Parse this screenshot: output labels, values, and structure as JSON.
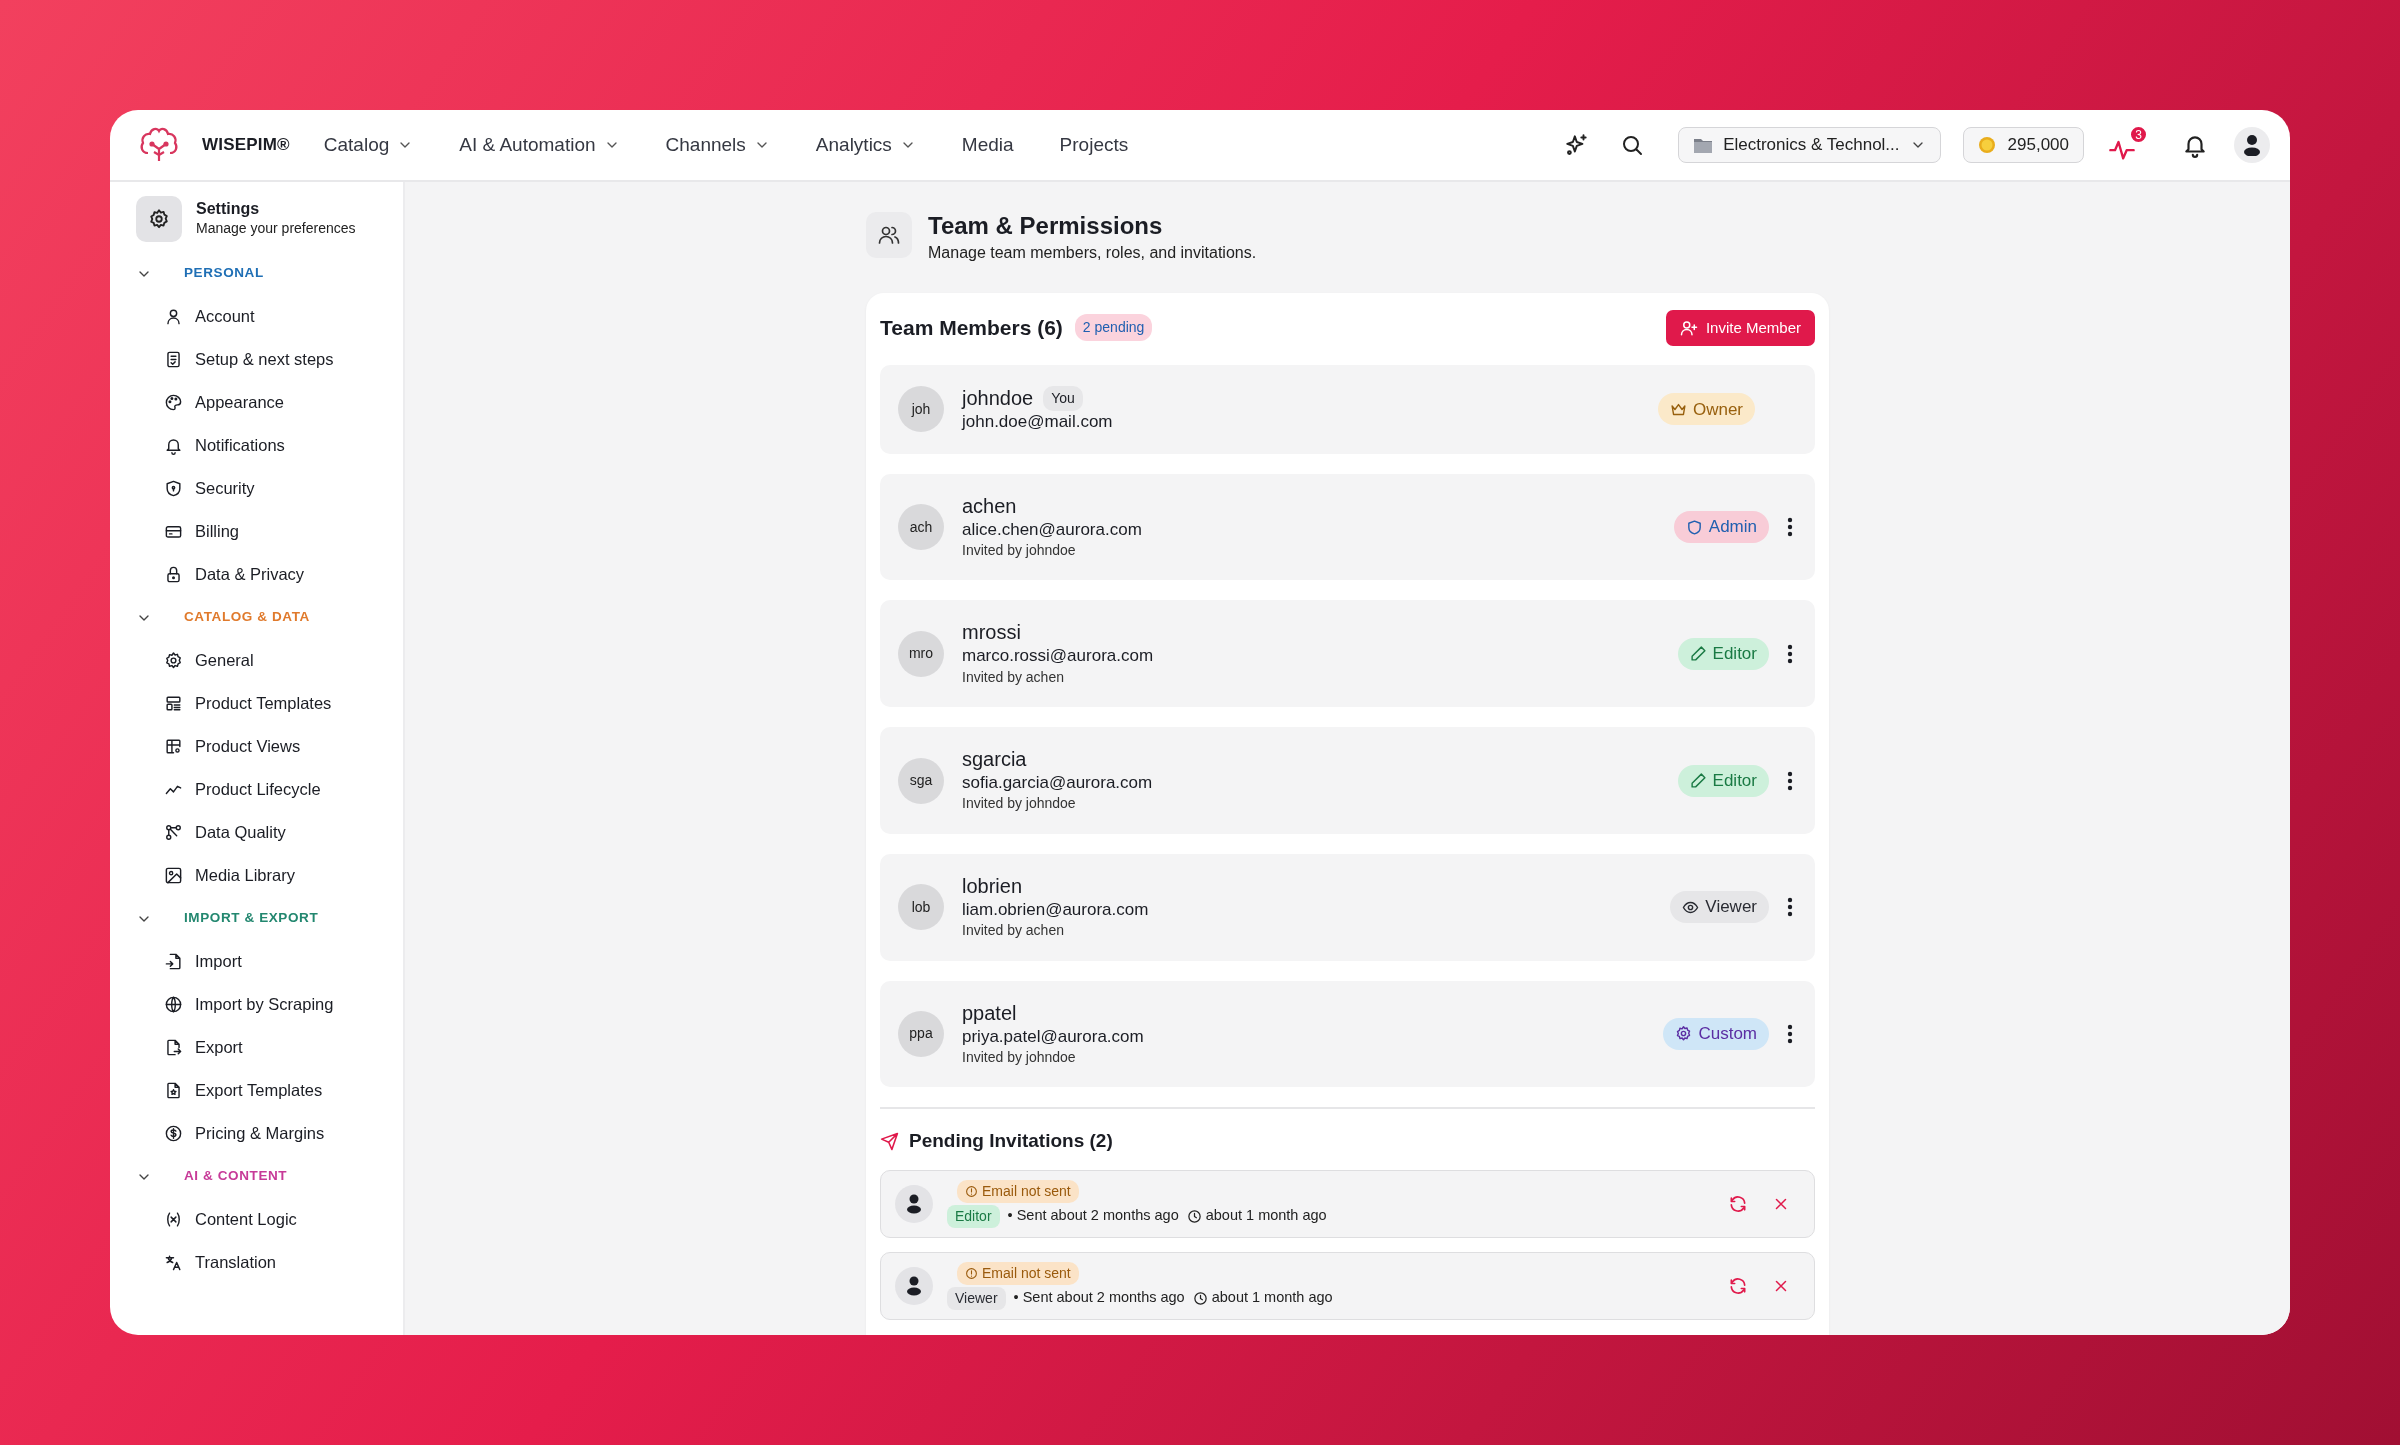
{
  "navbar": {
    "brand": "WISEPIM®",
    "menu": [
      {
        "label": "Catalog",
        "dropdown": true
      },
      {
        "label": "AI & Automation",
        "dropdown": true
      },
      {
        "label": "Channels",
        "dropdown": true
      },
      {
        "label": "Analytics",
        "dropdown": true
      },
      {
        "label": "Media",
        "dropdown": false
      },
      {
        "label": "Projects",
        "dropdown": false
      }
    ],
    "workspace": "Electronics & Technol...",
    "credits": "295,000",
    "activity_count": "3"
  },
  "sidebar": {
    "title": "Settings",
    "subtitle": "Manage your preferences",
    "sections": [
      {
        "title": "PERSONAL",
        "color": "#1f6fb5",
        "expanded": true,
        "items": [
          "Account",
          "Setup & next steps",
          "Appearance",
          "Notifications",
          "Security",
          "Billing",
          "Data & Privacy"
        ]
      },
      {
        "title": "CATALOG & DATA",
        "color": "#e07a2c",
        "expanded": true,
        "items": [
          "General",
          "Product Templates",
          "Product Views",
          "Product Lifecycle",
          "Data Quality",
          "Media Library"
        ]
      },
      {
        "title": "IMPORT & EXPORT",
        "color": "#22876f",
        "expanded": true,
        "items": [
          "Import",
          "Import by Scraping",
          "Export",
          "Export Templates",
          "Pricing & Margins"
        ]
      },
      {
        "title": "AI & CONTENT",
        "color": "#c73a98",
        "expanded": true,
        "items": [
          "Content Logic",
          "Translation"
        ]
      }
    ]
  },
  "page": {
    "title": "Team & Permissions",
    "subtitle": "Manage team members, roles, and invitations."
  },
  "team": {
    "title": "Team Members (6)",
    "pending_badge": "2 pending",
    "invite_button": "Invite Member",
    "members": [
      {
        "initials": "joh",
        "name": "johndoe",
        "tag": "You",
        "email": "john.doe@mail.com",
        "role": {
          "label": "Owner",
          "kind": "owner"
        },
        "has_menu": false
      },
      {
        "initials": "ach",
        "name": "achen",
        "email": "alice.chen@aurora.com",
        "invited_by": "Invited by johndoe",
        "role": {
          "label": "Admin",
          "kind": "admin"
        },
        "has_menu": true
      },
      {
        "initials": "mro",
        "name": "mrossi",
        "email": "marco.rossi@aurora.com",
        "invited_by": "Invited by achen",
        "role": {
          "label": "Editor",
          "kind": "editor"
        },
        "has_menu": true
      },
      {
        "initials": "sga",
        "name": "sgarcia",
        "email": "sofia.garcia@aurora.com",
        "invited_by": "Invited by johndoe",
        "role": {
          "label": "Editor",
          "kind": "editor"
        },
        "has_menu": true
      },
      {
        "initials": "lob",
        "name": "lobrien",
        "email": "liam.obrien@aurora.com",
        "invited_by": "Invited by achen",
        "role": {
          "label": "Viewer",
          "kind": "viewer"
        },
        "has_menu": true
      },
      {
        "initials": "ppa",
        "name": "ppatel",
        "email": "priya.patel@aurora.com",
        "invited_by": "Invited by johndoe",
        "role": {
          "label": "Custom",
          "kind": "custom"
        },
        "has_menu": true
      }
    ]
  },
  "pending": {
    "title": "Pending Invitations (2)",
    "invitations": [
      {
        "status": "Email not sent",
        "role": {
          "label": "Editor",
          "kind": "editor"
        },
        "sent": "• Sent about 2 months ago",
        "expires": "about 1 month ago"
      },
      {
        "status": "Email not sent",
        "role": {
          "label": "Viewer",
          "kind": "viewer"
        },
        "sent": "• Sent about 2 months ago",
        "expires": "about 1 month ago"
      }
    ]
  }
}
